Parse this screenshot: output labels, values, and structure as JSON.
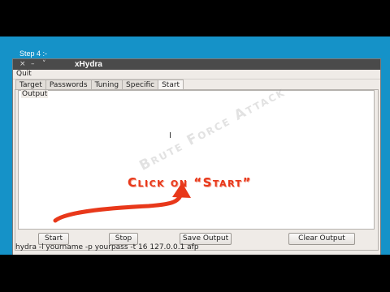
{
  "slide": {
    "step_label": "Step 4 :-"
  },
  "window": {
    "controls": [
      "×",
      "–",
      "˅"
    ],
    "title": "xHydra",
    "menu": [
      "Quit"
    ]
  },
  "tabs": [
    {
      "label": "Target",
      "active": false
    },
    {
      "label": "Passwords",
      "active": false
    },
    {
      "label": "Tuning",
      "active": false
    },
    {
      "label": "Specific",
      "active": false
    },
    {
      "label": "Start",
      "active": true
    }
  ],
  "output": {
    "frame_label": "Output",
    "cursor_glyph": "I",
    "watermark": "Brute Force Attack",
    "annotation": "Click on “Start”"
  },
  "buttons": {
    "start": "Start",
    "stop": "Stop",
    "save_output": "Save Output",
    "clear_output": "Clear Output"
  },
  "command_line": "hydra -l yourname -p yourpass -t 16 127.0.0.1 afp",
  "colors": {
    "slide_bg": "#1592c8",
    "annotation": "#e8381a",
    "arrow": "#e8381a",
    "window_bg": "#efebe7"
  }
}
